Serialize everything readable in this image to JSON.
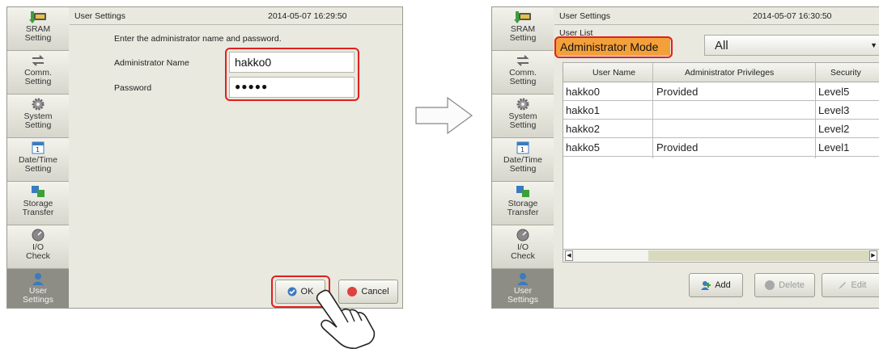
{
  "left": {
    "sidebar": [
      {
        "label": "SRAM\nSetting"
      },
      {
        "label": "Comm.\nSetting"
      },
      {
        "label": "System\nSetting"
      },
      {
        "label": "Date/Time\nSetting"
      },
      {
        "label": "Storage\nTransfer"
      },
      {
        "label": "I/O\nCheck"
      },
      {
        "label": "User\nSettings"
      }
    ],
    "title": "User Settings",
    "timestamp": "2014-05-07  16:29:50",
    "instruction": "Enter the administrator name and password.",
    "admin_name_label": "Administrator Name",
    "admin_name_value": "hakko0",
    "password_label": "Password",
    "password_value": "●●●●●",
    "ok_label": "OK",
    "cancel_label": "Cancel"
  },
  "right": {
    "sidebar": [
      {
        "label": "SRAM\nSetting"
      },
      {
        "label": "Comm.\nSetting"
      },
      {
        "label": "System\nSetting"
      },
      {
        "label": "Date/Time\nSetting"
      },
      {
        "label": "Storage\nTransfer"
      },
      {
        "label": "I/O\nCheck"
      },
      {
        "label": "User\nSettings"
      }
    ],
    "title": "User Settings",
    "timestamp": "2014-05-07  16:30:50",
    "section_label": "User List",
    "mode_label": "Administrator Mode",
    "filter_value": "All",
    "table": {
      "headers": [
        "User Name",
        "Administrator Privileges",
        "Security"
      ],
      "rows": [
        [
          "hakko0",
          "Provided",
          "Level5"
        ],
        [
          "hakko1",
          "",
          "Level3"
        ],
        [
          "hakko2",
          "",
          "Level2"
        ],
        [
          "hakko5",
          "Provided",
          "Level1"
        ]
      ]
    },
    "add_label": "Add",
    "delete_label": "Delete",
    "edit_label": "Edit"
  },
  "colors": {
    "highlight": "#e02020",
    "mode_bg": "#f4a03a",
    "active_sidebar": "#8d8d85"
  },
  "icons": [
    "sram-icon",
    "comm-icon",
    "gear-icon",
    "calendar-icon",
    "storage-icon",
    "io-gauge-icon",
    "user-icon",
    "arrow-right-icon",
    "pointing-hand-icon"
  ]
}
